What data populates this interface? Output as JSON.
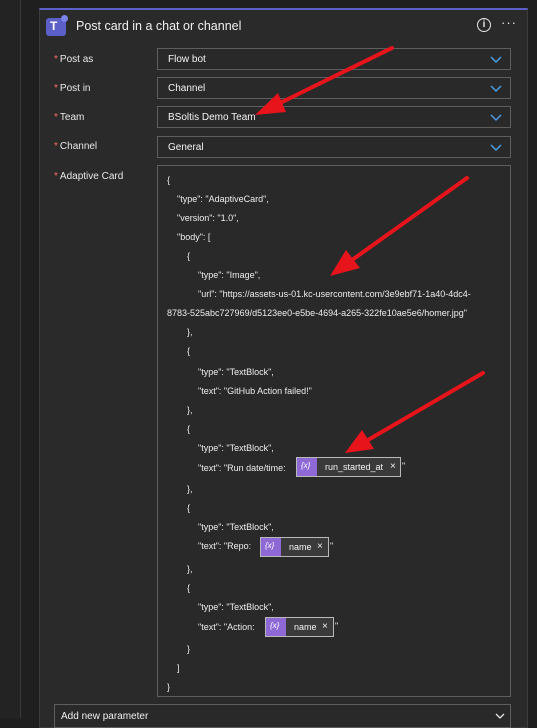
{
  "card": {
    "title": "Post card in a chat or channel",
    "info_glyph": "i",
    "more_glyph": "···"
  },
  "fields": {
    "post_as": {
      "label": "Post as",
      "value": "Flow bot"
    },
    "post_in": {
      "label": "Post in",
      "value": "Channel"
    },
    "team": {
      "label": "Team",
      "value": "BSoltis Demo Team"
    },
    "channel": {
      "label": "Channel",
      "value": "General"
    },
    "adaptive_card": {
      "label": "Adaptive Card"
    }
  },
  "required_marker": "*",
  "code": {
    "l1": "{",
    "l2": "\"type\": \"AdaptiveCard\",",
    "l3": "\"version\": \"1.0\",",
    "l4": "\"body\": [",
    "l5": "{",
    "l6": "\"type\": \"Image\",",
    "l7": "\"url\": \"https://assets-us-01.kc-usercontent.com/3e9ebf71-1a40-4dc4-",
    "l8": "8783-525abc727969/d5123ee0-e5be-4694-a265-322fe10ae5e6/homer.jpg\"",
    "l9": "},",
    "l10": "{",
    "l11": "\"type\": \"TextBlock\",",
    "l12": "\"text\": \"GitHub Action failed!\"",
    "l13": "},",
    "l14": "{",
    "l15": "\"type\": \"TextBlock\",",
    "l16": "\"text\": \"Run date/time:",
    "l17": "},",
    "l18": "{",
    "l19": "\"type\": \"TextBlock\",",
    "l20": "\"text\": \"Repo:",
    "l21": "},",
    "l22": "{",
    "l23": "\"type\": \"TextBlock\",",
    "l24": "\"text\": \"Action:",
    "l25": "}",
    "l26": "]",
    "l27": "}",
    "closing_quote": "\""
  },
  "tokens": {
    "run_started_at": "run_started_at",
    "repo_name": "name",
    "action_name": "name",
    "icon_glyph": "{x}",
    "remove_glyph": "×"
  },
  "add_parameter": {
    "label": "Add new parameter"
  },
  "colors": {
    "accent": "#5b5fc7",
    "token_icon": "#8e69d6",
    "annotation_arrow": "#e8141b"
  }
}
